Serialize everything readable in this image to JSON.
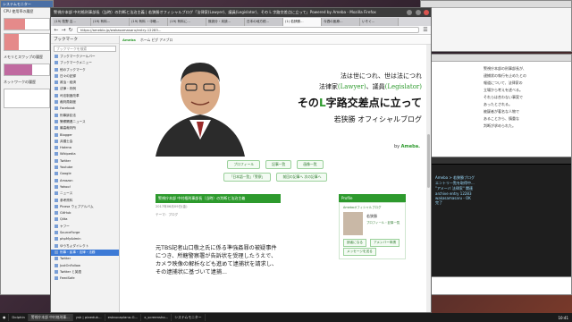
{
  "sysmon": {
    "title": "システムモニター",
    "cpu_label": "CPU 使用率の履歴",
    "mem_label": "メモリとスワップの履歴",
    "net_label": "ネットワークの履歴"
  },
  "firefox": {
    "window_title": "警視庁本部 中村格刑事部長（当時）の判断と法治主義 | 若狭勝オフィシャルブログ「法律家(Lawyer)、議員(Legislator)、その L 字路交差点に立って」Powered by Ameba - Mozilla Firefox",
    "tabs": [
      "(19) 牧野 吉…",
      "(19) 有料…",
      "(19) 有料 ・中略…",
      "(19) 有料に…",
      "既読分・未読…",
      "日本の地方税…",
      "(1) 若狭勝…",
      "今週の医療…",
      "いそぐ…"
    ],
    "url": "https://ameblo.jp/wakasamasaru/entry-12283..."
  },
  "sidebar": {
    "header": "ブックマーク",
    "search_placeholder": "ブックマークを検索",
    "items": [
      "ブックマークツールバー",
      "ブックマークメニュー",
      "他のブックマーク",
      "日々の記録",
      "政治・経済",
      "法律・判例",
      "司法制度改革",
      "裁判員制度",
      "Facebook",
      "刑事訴訟法",
      "警察関連ニュース",
      "最高裁判所",
      "Blogger",
      "弁護士会",
      "Hatena",
      "Wikipedia",
      "Twitter",
      "Youtube",
      "Google",
      "Amazon",
      "Yahoo!",
      "ニュース",
      "参考資料",
      "Picasa ウェブアルバム",
      "GitHub",
      "Qiita",
      "ヤフー",
      "SourceForge",
      "phpMyAdmin",
      "ゆうちょダイレクト",
      "刑事・民事・法律・法務",
      "Twitter",
      "JustOnFollow",
      "Twitter と英語",
      "FeedSafe"
    ]
  },
  "blog": {
    "ameba_logo": "Ameba",
    "top_links": "ホーム  ピグ  アメブロ",
    "hero_line1": "法は世につれ、世は法につれ",
    "hero_line2a": "法律家",
    "hero_line2b": "(Lawyer)",
    "hero_line2c": "、議員",
    "hero_line2d": "(Legislator)",
    "hero_line3a": "その",
    "hero_line3b": "L",
    "hero_line3c": "字路交差点に立って",
    "hero_line4": "若狭勝 オフィシャルブログ",
    "by_label": "by",
    "by_ameba": "Ameba.",
    "menu": [
      "プロフィール",
      "記事一覧",
      "画像一覧"
    ],
    "sub_menu": [
      "「日本語一覧」「警察」",
      "前回の記事へ 次の記事へ"
    ],
    "post_title": "警視庁本部 中村格刑事部長（当時）の判断と法治主義",
    "post_date": "2017年06月09日(金)",
    "post_theme": "テーマ：ブログ",
    "post_body": "元TBS記者山口敬之氏に係る準強姦罪の被疑事件につき、所轄警察署が告訴状を受理したうえで、カメラ映像の解析なども進めて逮捕状を請求し、その逮捕状に基づいて逮捕...",
    "profile_head": "Profile",
    "profile_title": "Amebaオフィシャルブログ",
    "profile_name": "若狭勝",
    "profile_sub": "プロフィール・記事一覧",
    "btn_reader": "読者になる",
    "btn_message": "メッセージを送る",
    "btn_ameba": "アメンバー申請"
  },
  "right": {
    "lines": [
      "警視庁本部の刑事部長が、",
      "逮捕状の執行を止めたとの",
      "報道について、法律家の",
      "立場から考えを述べる。",
      "それらは合わない事案で",
      "あったとされる。",
      "被疑者が著名な人物で",
      "あることから、慎重な",
      "判断が求められた。"
    ],
    "term_lines": [
      "Ameba > 若狭勝ブログ",
      "エントリ一覧を取得中...",
      "\"アメーバ 法律家\" 関連",
      "archive entry 12283",
      "wakasamasaru - OK",
      "完了"
    ]
  },
  "taskbar": {
    "items": [
      "Dolphin",
      "警視庁本部 中村格刑事...",
      "ysk | plaeduk...",
      "estaucaplano-G...",
      "x_screensho...",
      "システムモニター"
    ],
    "clock": "10:41"
  },
  "chart_levels": {
    "cpu_percent": 45,
    "mem_percent": 62
  }
}
